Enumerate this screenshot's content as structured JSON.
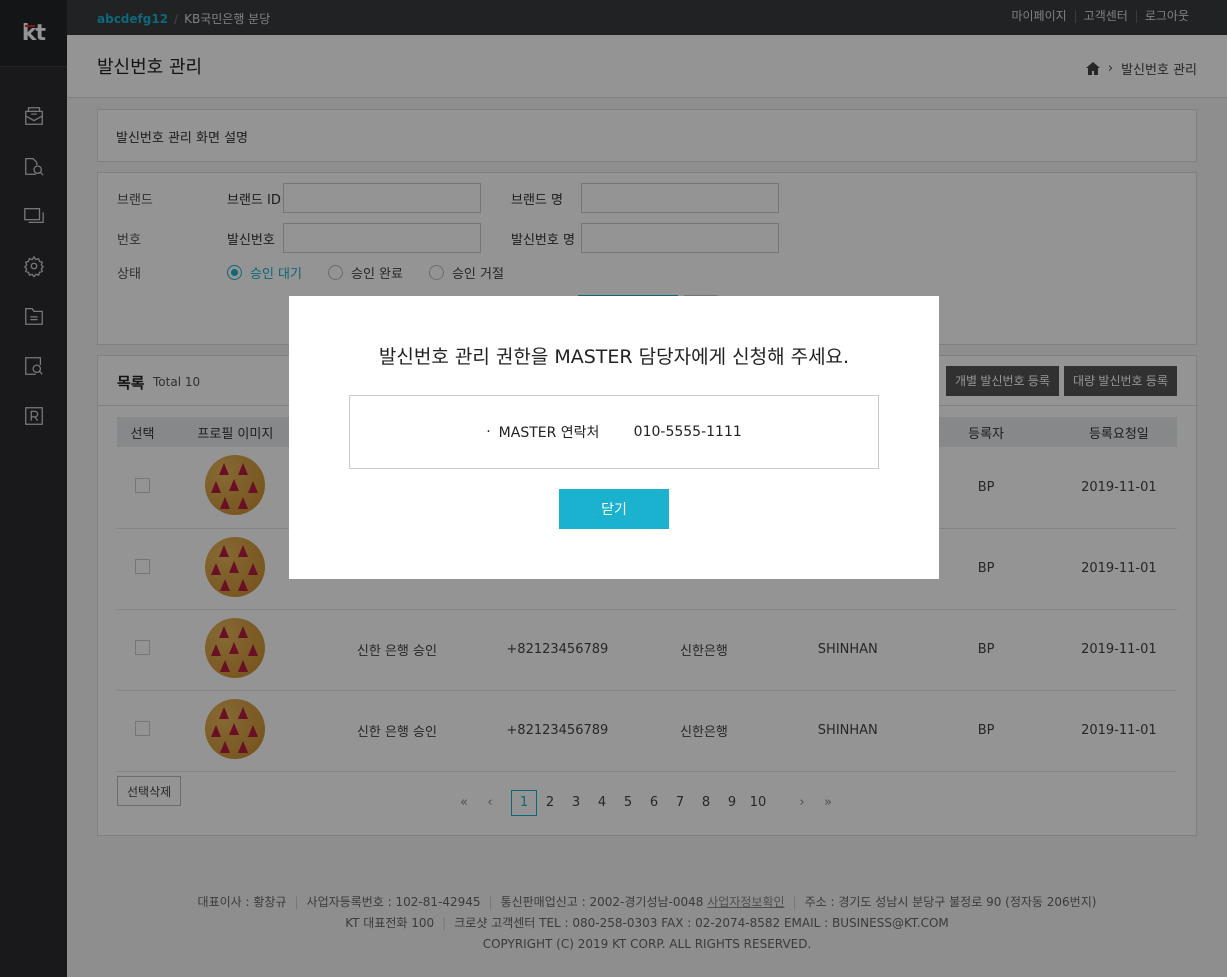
{
  "brand": "kt",
  "topbar": {
    "user_id": "abcdefg12",
    "branch": "KB국민은행 분당",
    "links": [
      "마이페이지",
      "고객센터",
      "로그아웃"
    ]
  },
  "header": {
    "title": "발신번호 관리",
    "breadcrumb": "발신번호 관리"
  },
  "description": "발신번호 관리 화면 설명",
  "search": {
    "brand_label": "브랜드",
    "brand_id_label": "브랜드 ID",
    "brand_name_label": "브랜드 명",
    "number_label": "번호",
    "sender_number_label": "발신번호",
    "sender_name_label": "발신번호 명",
    "status_label": "상태",
    "statuses": [
      "승인 대기",
      "승인 완료",
      "승인 거절"
    ]
  },
  "list": {
    "title": "목록",
    "total": "Total 10",
    "btn_single": "개별 발신번호 등록",
    "btn_bulk": "대량 발신번호 등록",
    "columns": [
      "선택",
      "프로필 이미지",
      "",
      "",
      "",
      "",
      "등록자",
      "등록요청일"
    ],
    "rows": [
      [
        "",
        "",
        "",
        "",
        "BP",
        "2019-11-01"
      ],
      [
        "",
        "",
        "",
        "",
        "BP",
        "2019-11-01"
      ],
      [
        "신한 은행 승인",
        "+82123456789",
        "신한은행",
        "SHINHAN",
        "BP",
        "2019-11-01"
      ],
      [
        "신한 은행 승인",
        "+82123456789",
        "신한은행",
        "SHINHAN",
        "BP",
        "2019-11-01"
      ]
    ],
    "delete_btn": "선택삭제",
    "pages": [
      "1",
      "2",
      "3",
      "4",
      "5",
      "6",
      "7",
      "8",
      "9",
      "10"
    ]
  },
  "footer": {
    "ceo": "대표이사 : 황창규",
    "biz_no": "사업자등록번호 : 102-81-42945",
    "mail_order": "통신판매업신고 : 2002-경기성남-0048",
    "biz_info": "사업자정보확인",
    "address": "주소 : 경기도 성남시 분당구 불정로 90 (정자동 206번지)",
    "tel": "KT 대표전화 100",
    "contact": "크로샷 고객센터 TEL : 080-258-0303 FAX : 02-2074-8582 EMAIL : BUSINESS@KT.COM",
    "copyright": "COPYRIGHT (C) 2019 KT CORP. ALL RIGHTS RESERVED."
  },
  "modal": {
    "title": "발신번호 관리 권한을 MASTER 담당자에게 신청해 주세요.",
    "contact_label": "MASTER 연락처",
    "contact_value": "010-5555-1111",
    "close": "닫기"
  }
}
